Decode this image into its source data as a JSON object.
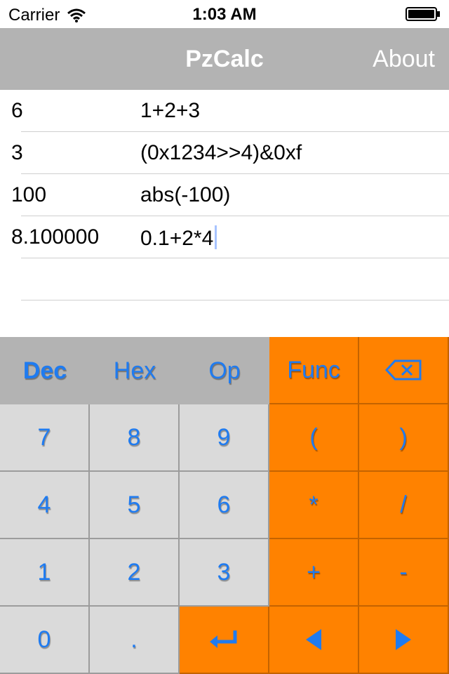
{
  "status": {
    "carrier": "Carrier",
    "time": "1:03 AM"
  },
  "nav": {
    "title": "PzCalc",
    "about": "About"
  },
  "history": [
    {
      "result": "6",
      "expr": "1+2+3"
    },
    {
      "result": "3",
      "expr": "(0x1234>>4)&0xf"
    },
    {
      "result": "100",
      "expr": "abs(-100)"
    },
    {
      "result": "8.100000",
      "expr": "0.1+2*4"
    }
  ],
  "tabs": {
    "dec": "Dec",
    "hex": "Hex",
    "op": "Op",
    "func": "Func",
    "active": "Dec"
  },
  "keys": {
    "k7": "7",
    "k8": "8",
    "k9": "9",
    "lparen": "(",
    "rparen": ")",
    "k4": "4",
    "k5": "5",
    "k6": "6",
    "mul": "*",
    "div": "/",
    "k1": "1",
    "k2": "2",
    "k3": "3",
    "plus": "+",
    "minus": "-",
    "k0": "0",
    "dot": "."
  },
  "colors": {
    "accent": "#1f7bf0",
    "orange": "#ff8200",
    "gray_key": "#dadada",
    "navbar": "#b3b3b3"
  },
  "icons": {
    "backspace": "backspace-icon",
    "enter": "enter-icon",
    "left": "arrow-left-icon",
    "right": "arrow-right-icon"
  }
}
